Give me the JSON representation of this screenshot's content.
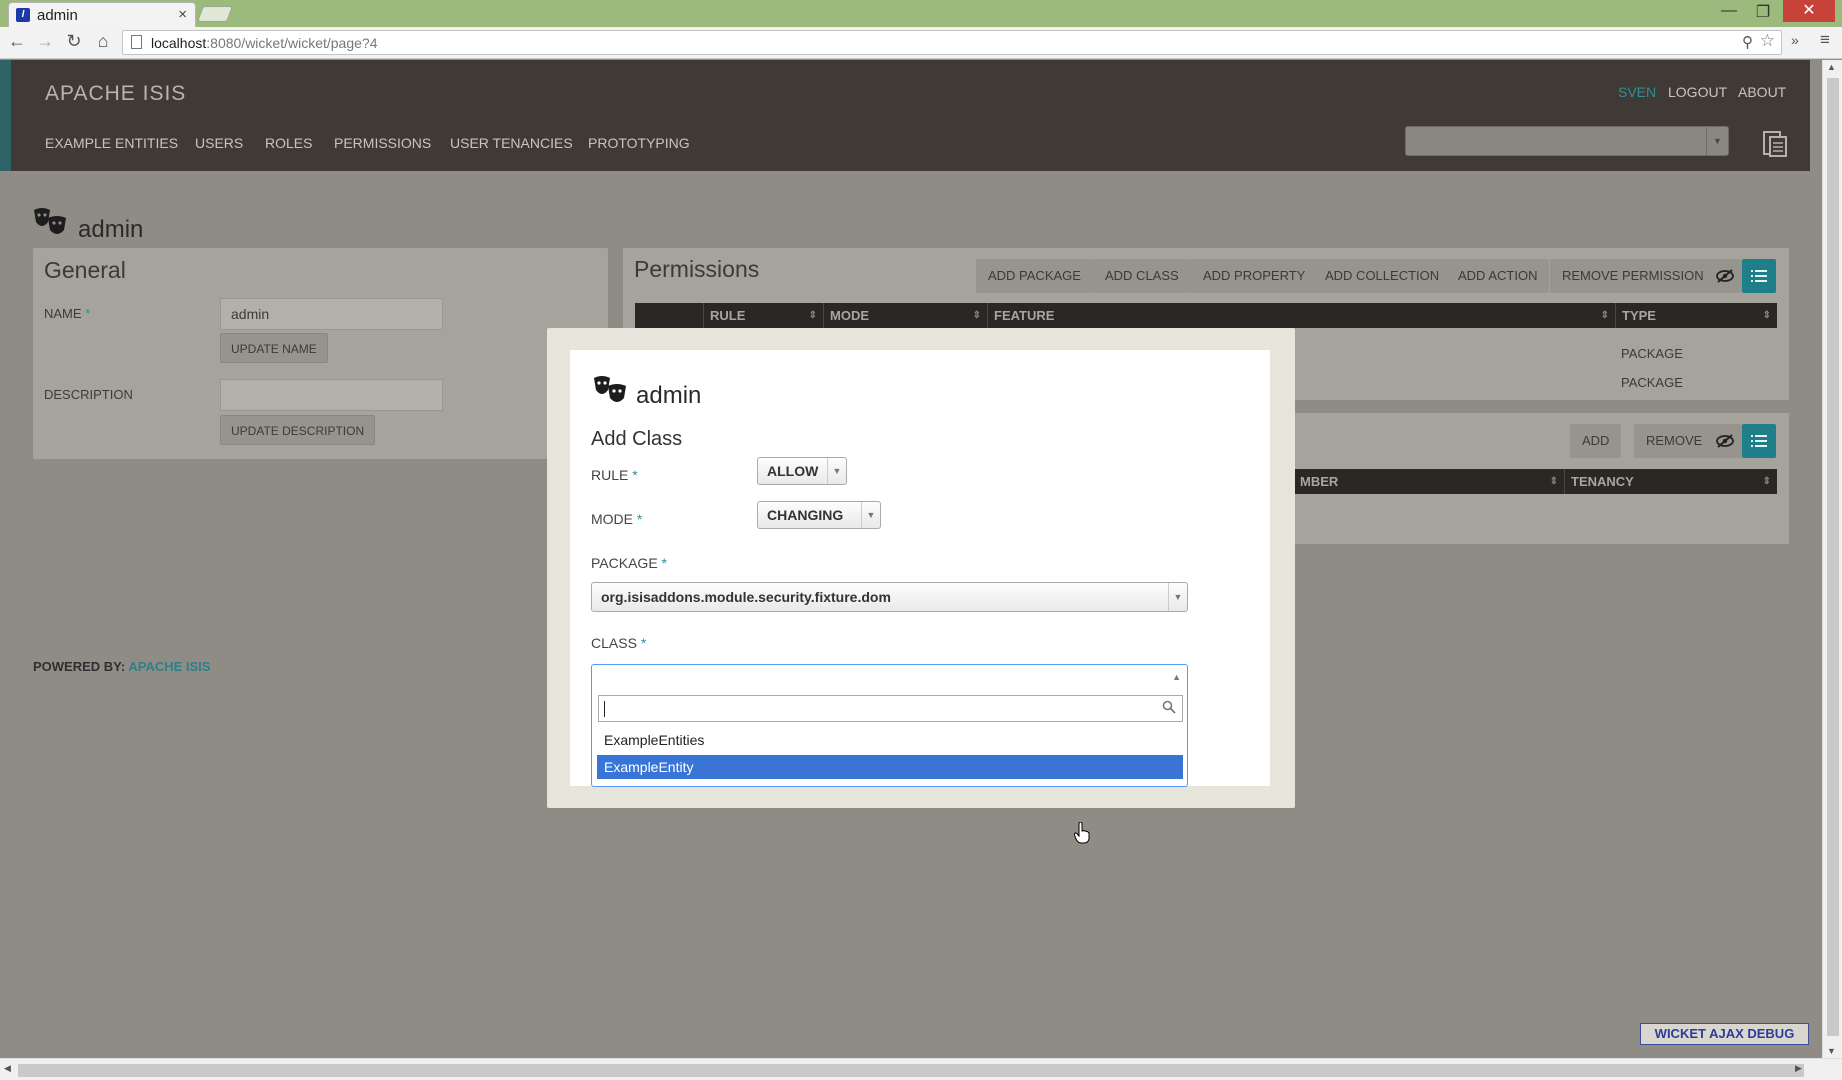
{
  "browser": {
    "tab_title": "admin",
    "tab_close": "×",
    "favicon_letter": "I",
    "url_host": "localhost",
    "url_path": ":8080/wicket/wicket/page?4",
    "win_min": "—",
    "win_max": "❐",
    "win_close": "✕",
    "back": "←",
    "forward": "→",
    "reload": "↻",
    "home": "⌂",
    "zoom": "⚲",
    "star": "☆",
    "ext": "»",
    "menu": "≡"
  },
  "app": {
    "brand": "APACHE ISIS",
    "nav": [
      "EXAMPLE ENTITIES",
      "USERS",
      "ROLES",
      "PERMISSIONS",
      "USER TENANCIES",
      "PROTOTYPING"
    ],
    "user": "SVEN",
    "logout": "LOGOUT",
    "about": "ABOUT",
    "search_arrow": "▼"
  },
  "page": {
    "title": "admin"
  },
  "general": {
    "title": "General",
    "name_label": "NAME",
    "required_mark": "*",
    "name_value": "admin",
    "update_name": "UPDATE NAME",
    "description_label": "DESCRIPTION",
    "description_value": "",
    "update_description": "UPDATE DESCRIPTION"
  },
  "powered": {
    "label": "POWERED BY:",
    "link": "APACHE ISIS"
  },
  "permissions": {
    "title": "Permissions",
    "actions": [
      "ADD PACKAGE",
      "ADD CLASS",
      "ADD PROPERTY",
      "ADD COLLECTION",
      "ADD ACTION",
      "REMOVE PERMISSION"
    ],
    "columns": [
      "RULE",
      "MODE",
      "FEATURE",
      "TYPE"
    ],
    "sort_glyph": "⇕",
    "rows": [
      {
        "type": "PACKAGE"
      },
      {
        "type": "PACKAGE"
      }
    ]
  },
  "users": {
    "actions": [
      "ADD",
      "REMOVE"
    ],
    "columns": [
      "MBER",
      "TENANCY"
    ]
  },
  "modal": {
    "title": "admin",
    "action_name": "Add Class",
    "rule_label": "RULE",
    "rule_value": "ALLOW",
    "mode_label": "MODE",
    "mode_value": "CHANGING",
    "package_label": "PACKAGE",
    "package_value": "org.isisaddons.module.security.fixture.dom",
    "class_label": "CLASS",
    "class_value": "",
    "class_search_value": "",
    "options": [
      "ExampleEntities",
      "ExampleEntity"
    ],
    "highlighted_option": "ExampleEntity",
    "arrow_down": "▼",
    "arrow_up": "▲"
  },
  "debug": {
    "label": "WICKET AJAX DEBUG"
  },
  "scroll": {
    "up": "▲",
    "down": "▼",
    "left": "◀",
    "right": "▶"
  },
  "colors": {
    "accent_teal": "#2f8f99",
    "header_bg": "#3f3a36",
    "overlay_bg": "#8e8c85",
    "highlight_blue": "#3875d7"
  }
}
